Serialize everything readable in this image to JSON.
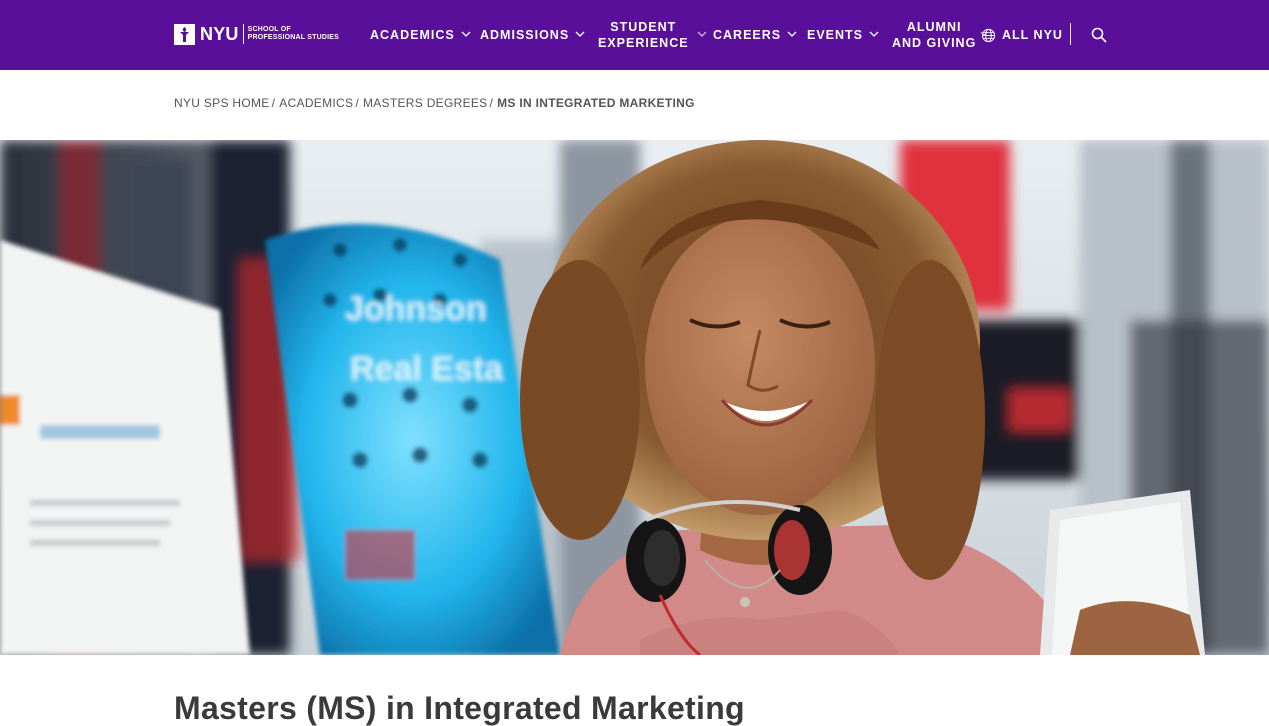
{
  "brand": {
    "logo_text": "NYU",
    "school_line1": "SCHOOL OF",
    "school_line2": "PROFESSIONAL STUDIES",
    "purple": "#5a0f9b"
  },
  "nav": {
    "items": [
      {
        "line1": "ACADEMICS",
        "line2": "",
        "icon": "chevron-down-icon"
      },
      {
        "line1": "ADMISSIONS",
        "line2": "",
        "icon": "chevron-down-icon"
      },
      {
        "line1": "STUDENT",
        "line2": "EXPERIENCE",
        "icon": "chevron-down-icon"
      },
      {
        "line1": "CAREERS",
        "line2": "",
        "icon": "chevron-down-icon"
      },
      {
        "line1": "EVENTS",
        "line2": "",
        "icon": "chevron-down-icon"
      },
      {
        "line1": "ALUMNI",
        "line2": "AND GIVING",
        "icon": "chevron-down-icon"
      }
    ],
    "all_nyu": "ALL NYU",
    "all_nyu_icon": "globe-icon",
    "search_icon": "search-icon"
  },
  "breadcrumb": {
    "items": [
      "NYU SPS HOME",
      "ACADEMICS",
      "MASTERS DEGREES"
    ],
    "current": "MS IN INTEGRATED MARKETING",
    "separator": "/"
  },
  "hero": {
    "image": "hero-photo-student-with-headphones-times-square"
  },
  "page": {
    "title": "Masters (MS) in Integrated Marketing"
  }
}
